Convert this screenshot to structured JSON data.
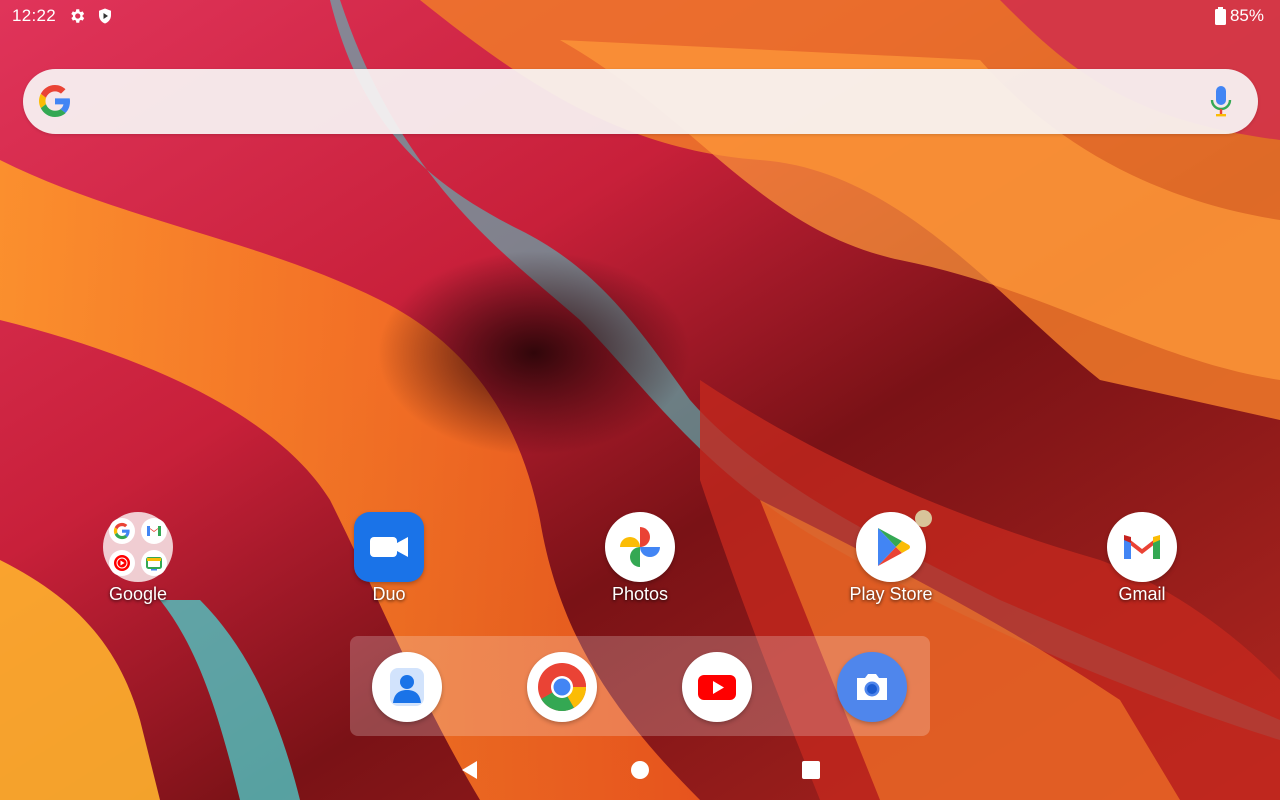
{
  "status_bar": {
    "time": "12:22",
    "icons": [
      "gear-icon",
      "shield-play-icon"
    ],
    "battery_percent": "85%"
  },
  "search_bar": {
    "logo": "google-g-icon",
    "mic": "mic-icon"
  },
  "apps": [
    {
      "label": "Google",
      "icon": "google-folder-icon"
    },
    {
      "label": "Duo",
      "icon": "duo-icon"
    },
    {
      "label": "Photos",
      "icon": "photos-icon"
    },
    {
      "label": "Play Store",
      "icon": "play-store-icon",
      "has_notification_dot": true
    },
    {
      "label": "Gmail",
      "icon": "gmail-icon"
    }
  ],
  "folder_contents": [
    "google-icon",
    "gmail-icon",
    "youtube-music-icon",
    "google-tv-icon"
  ],
  "dock": [
    "contacts-icon",
    "chrome-icon",
    "youtube-icon",
    "camera-icon"
  ],
  "nav_bar": [
    "back-icon",
    "home-icon",
    "recents-icon"
  ],
  "colors": {
    "google_blue": "#4285F4",
    "google_red": "#EA4335",
    "google_yellow": "#FBBC05",
    "google_green": "#34A853",
    "duo_blue": "#1A73E8",
    "youtube_red": "#FF0000"
  }
}
